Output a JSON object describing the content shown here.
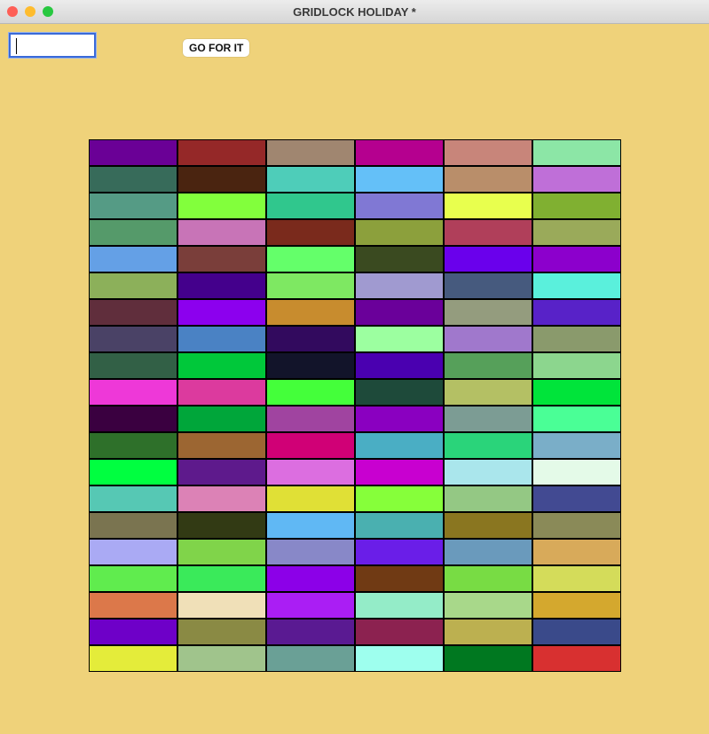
{
  "window": {
    "title": "GRIDLOCK HOLIDAY *"
  },
  "input": {
    "value": ""
  },
  "button": {
    "label": "GO FOR IT"
  },
  "colors": {
    "background": "#efd27a"
  },
  "grid": [
    [
      "#6a0096",
      "#952828",
      "#a08670",
      "#b5008f",
      "#c8857a",
      "#8ce6a6"
    ],
    [
      "#376b5a",
      "#4a2410",
      "#4ecdb9",
      "#64c0f8",
      "#b98e6a",
      "#bf6fd8"
    ],
    [
      "#559b85",
      "#82ff3c",
      "#30c78d",
      "#8078d4",
      "#e8ff4e",
      "#80b031"
    ],
    [
      "#559a6a",
      "#c874b7",
      "#7a2a1c",
      "#8ca03c",
      "#b03f5a",
      "#9aaa5a"
    ],
    [
      "#64a0e6",
      "#7a3e3a",
      "#64ff6a",
      "#3a4a20",
      "#6a00ec",
      "#8c00cc"
    ],
    [
      "#8cb05a",
      "#44008c",
      "#7ee862",
      "#a09ad0",
      "#465a7e",
      "#5af0dc"
    ],
    [
      "#602e3c",
      "#8c00ee",
      "#c88c2e",
      "#6a009a",
      "#949c7e",
      "#5822c8"
    ],
    [
      "#4a4266",
      "#4a82c4",
      "#320a5e",
      "#9cffa0",
      "#a078cc",
      "#8a9a6c"
    ],
    [
      "#326046",
      "#00c83a",
      "#12142a",
      "#4a00b0",
      "#56a05a",
      "#8cd68e"
    ],
    [
      "#ee38d8",
      "#dc3a9e",
      "#44ff3a",
      "#1e4a3a",
      "#b4c064",
      "#00e43a"
    ],
    [
      "#3a0040",
      "#00a63a",
      "#a044a0",
      "#8a00c0",
      "#7c9c94",
      "#4aff96"
    ],
    [
      "#2e702a",
      "#9c6632",
      "#d00076",
      "#4aaec4",
      "#2ad47a",
      "#7aaec8"
    ],
    [
      "#00ff40",
      "#5e1a8c",
      "#dc6ee0",
      "#c800d0",
      "#aae6ec",
      "#e4fae8"
    ],
    [
      "#56c8b4",
      "#dc82b6",
      "#e0e036",
      "#86ff3a",
      "#94c884",
      "#424a92"
    ],
    [
      "#7a7450",
      "#323a14",
      "#60b8f4",
      "#4ab0b0",
      "#8a7620",
      "#8a8a58"
    ],
    [
      "#aaaaf4",
      "#80d44a",
      "#8888c8",
      "#6a1ee8",
      "#6a9abc",
      "#d8aa5a"
    ],
    [
      "#60ec4e",
      "#3aea5a",
      "#8c00e8",
      "#703a14",
      "#78dc44",
      "#d4dc5a"
    ],
    [
      "#dc784a",
      "#f0e0b8",
      "#aa1ef4",
      "#94ecc8",
      "#a8d88a",
      "#d4a82e"
    ],
    [
      "#6e00c8",
      "#8a8a44",
      "#5a1a92",
      "#8c2250",
      "#bcb050",
      "#3a4a8a"
    ],
    [
      "#e4ec3a",
      "#a0c48c",
      "#6aa096",
      "#9effee",
      "#007820",
      "#d83030"
    ]
  ]
}
